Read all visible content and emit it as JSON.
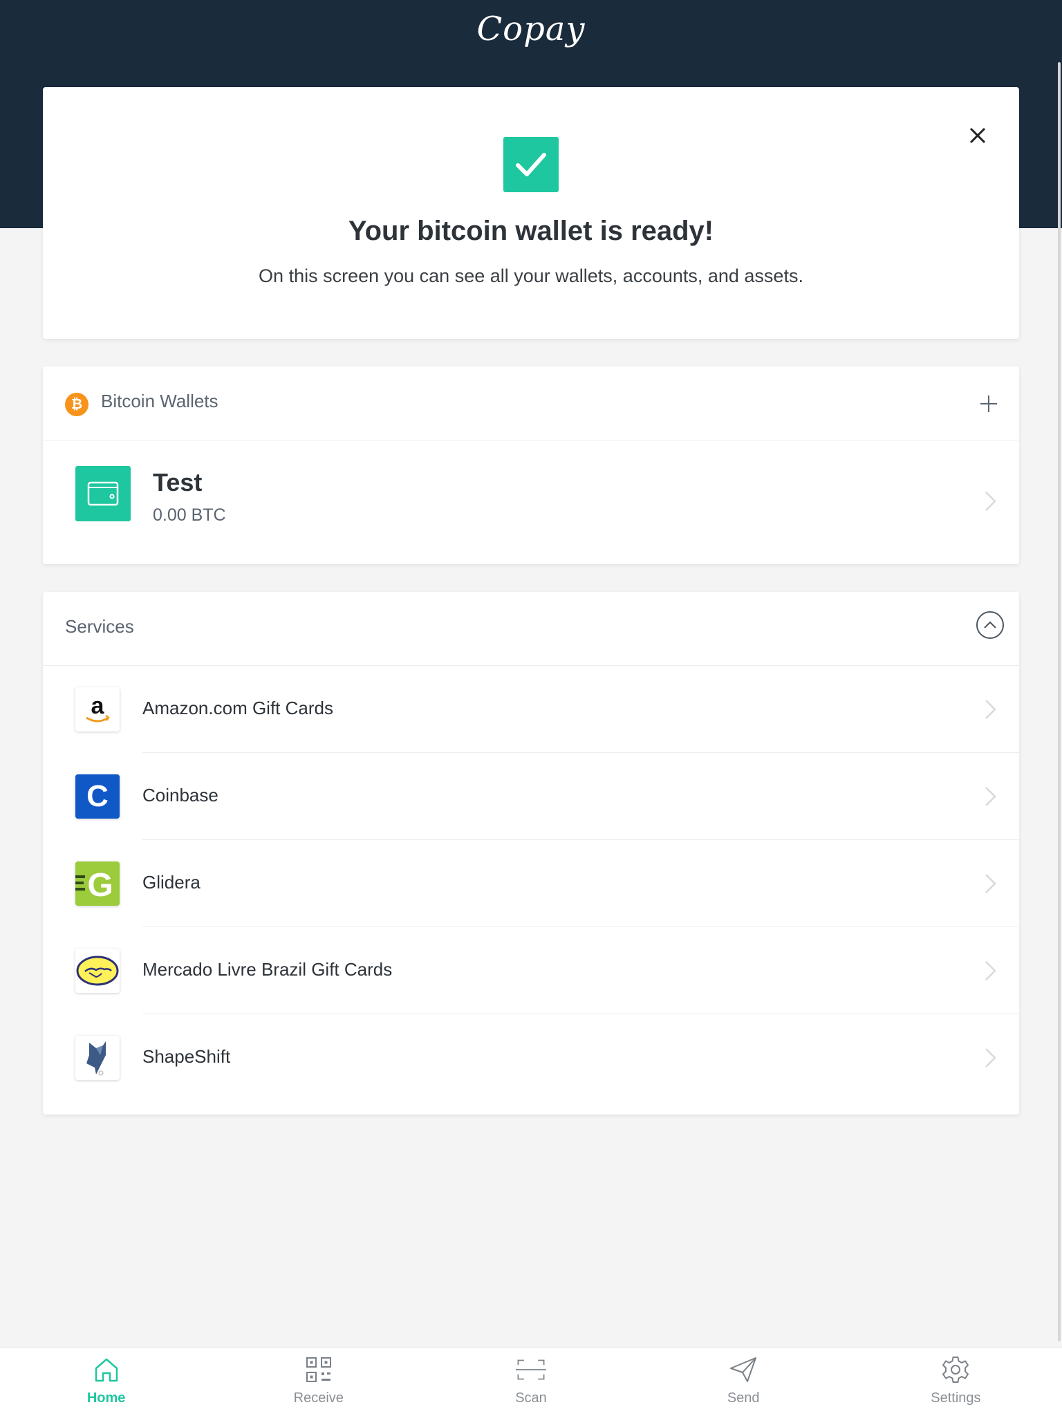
{
  "header": {
    "app_name": "Copay"
  },
  "ready_card": {
    "title": "Your bitcoin wallet is ready!",
    "subtitle": "On this screen you can see all your wallets, accounts, and assets.",
    "icon": "check-icon",
    "close_icon": "close-icon"
  },
  "wallets": {
    "title": "Bitcoin Wallets",
    "currency_symbol": "₿",
    "add_icon": "plus-icon",
    "items": [
      {
        "name": "Test",
        "balance": "0.00 BTC"
      }
    ]
  },
  "services": {
    "title": "Services",
    "collapse_icon": "chevron-up-icon",
    "items": [
      {
        "label": "Amazon.com Gift Cards",
        "logo_text": "a"
      },
      {
        "label": "Coinbase",
        "logo_text": "C"
      },
      {
        "label": "Glidera",
        "logo_text": "G"
      },
      {
        "label": "Mercado Livre Brazil Gift Cards"
      },
      {
        "label": "ShapeShift"
      }
    ]
  },
  "bottom_nav": {
    "items": [
      {
        "label": "Home",
        "icon": "home-icon",
        "active": true
      },
      {
        "label": "Receive",
        "icon": "qr-code-icon",
        "active": false
      },
      {
        "label": "Scan",
        "icon": "scan-icon",
        "active": false
      },
      {
        "label": "Send",
        "icon": "send-icon",
        "active": false
      },
      {
        "label": "Settings",
        "icon": "gear-icon",
        "active": false
      }
    ]
  },
  "colors": {
    "header": "#1a2b3c",
    "accent": "#1ec79f",
    "bitcoin": "#f7931a"
  }
}
